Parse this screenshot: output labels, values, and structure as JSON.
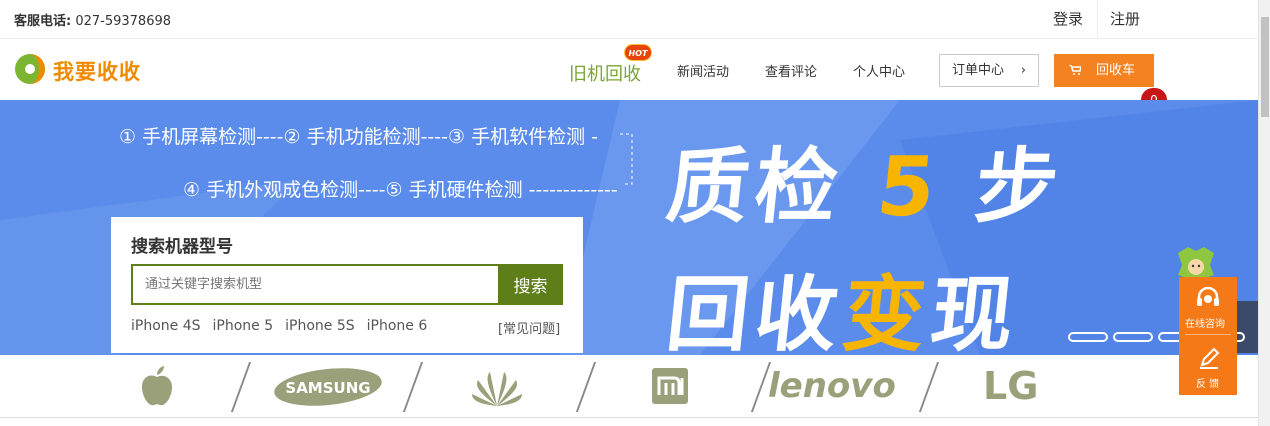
{
  "topbar": {
    "hotline_label": "客服电话:",
    "hotline_number": "027-59378698",
    "login": "登录",
    "register": "注册"
  },
  "nav": {
    "logo_text": "我要收收",
    "old_machine": "旧机回收",
    "hot_badge": "HOT",
    "news": "新闻活动",
    "reviews": "查看评论",
    "personal": "个人中心",
    "order": "订单中心",
    "order_chevron": "›",
    "cart": "回收车",
    "cart_count": "0"
  },
  "banner": {
    "step1": "① 手机屏幕检测----② 手机功能检测----③ 手机软件检测 -",
    "step2": "④ 手机外观成色检测----⑤ 手机硬件检测 -------------",
    "headline1_a": "质检 ",
    "headline1_b": "5",
    "headline1_c": " 步",
    "headline2_a": "回收",
    "headline2_b": "变",
    "headline2_c": "现",
    "next_arrow": "›",
    "slides": 4
  },
  "search": {
    "title": "搜索机器型号",
    "placeholder": "通过关键字搜索机型",
    "button": "搜索",
    "hot_models": [
      "iPhone 4S",
      "iPhone 5",
      "iPhone 5S",
      "iPhone 6"
    ],
    "faq": "[常见问题]"
  },
  "brands": [
    "apple-logo",
    "SAMSUNG",
    "huawei-logo",
    "mi-logo",
    "lenovo",
    "LG"
  ],
  "side": {
    "consult": "在线咨询",
    "feedback": "反 馈"
  },
  "colors": {
    "orange": "#f58220",
    "green": "#5e7e1a",
    "banner": "#5b8ceb",
    "accent_yellow": "#f7b500"
  }
}
